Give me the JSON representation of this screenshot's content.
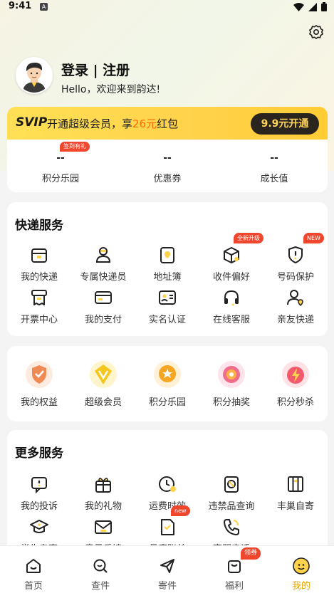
{
  "status_bar": {
    "time": "9:41",
    "a_label": "A"
  },
  "profile": {
    "title": "登录 | 注册",
    "welcome": "Hello，欢迎来到韵达!"
  },
  "svip": {
    "logo": "SVIP",
    "text_before": "开通超级会员，享",
    "amount": "26元",
    "text_after": "红包",
    "button": "9.9元开通"
  },
  "stats": [
    {
      "value": "--",
      "label": "积分乐园",
      "badge": "签到有礼"
    },
    {
      "value": "--",
      "label": "优惠券"
    },
    {
      "value": "--",
      "label": "成长值"
    }
  ],
  "express": {
    "title": "快递服务",
    "items": [
      {
        "label": "我的快递",
        "icon": "package-icon"
      },
      {
        "label": "专属快递员",
        "icon": "courier-icon"
      },
      {
        "label": "地址簿",
        "icon": "address-book-icon"
      },
      {
        "label": "收件偏好",
        "icon": "receive-preference-icon",
        "badge": "全新升级"
      },
      {
        "label": "号码保护",
        "icon": "number-protection-icon",
        "badge": "NEW"
      },
      {
        "label": "开票中心",
        "icon": "invoice-icon"
      },
      {
        "label": "我的支付",
        "icon": "payment-card-icon"
      },
      {
        "label": "实名认证",
        "icon": "id-card-icon"
      },
      {
        "label": "在线客服",
        "icon": "headset-icon"
      },
      {
        "label": "亲友快递",
        "icon": "friends-icon"
      }
    ]
  },
  "benefits": {
    "items": [
      {
        "label": "我的权益",
        "icon": "rights-shield-icon",
        "color": "#f08a54"
      },
      {
        "label": "超级会员",
        "icon": "super-member-icon",
        "color": "#f5c61d"
      },
      {
        "label": "积分乐园",
        "icon": "points-medal-icon",
        "color": "#f5a623"
      },
      {
        "label": "积分抽奖",
        "icon": "lottery-icon",
        "color": "#f06e8c"
      },
      {
        "label": "积分秒杀",
        "icon": "flash-sale-icon",
        "color": "#f25a6e"
      }
    ]
  },
  "more": {
    "title": "更多服务",
    "items": [
      {
        "label": "我的投诉",
        "icon": "complaint-icon"
      },
      {
        "label": "我的礼物",
        "icon": "gift-icon"
      },
      {
        "label": "运费时效",
        "icon": "freight-time-icon"
      },
      {
        "label": "违禁品查询",
        "icon": "prohibited-items-icon"
      },
      {
        "label": "丰巢自寄",
        "icon": "locker-icon"
      },
      {
        "label": "学生专享",
        "icon": "graduation-cap-icon"
      },
      {
        "label": "意见反馈",
        "icon": "feedback-icon"
      },
      {
        "label": "月度账单",
        "icon": "monthly-bill-icon",
        "badge": "new"
      },
      {
        "label": "客服电话",
        "icon": "phone-icon"
      }
    ]
  },
  "tabs": [
    {
      "label": "首页",
      "icon": "home-icon"
    },
    {
      "label": "查件",
      "icon": "search-icon"
    },
    {
      "label": "寄件",
      "icon": "send-icon"
    },
    {
      "label": "福利",
      "icon": "welfare-bag-icon",
      "badge": "领券"
    },
    {
      "label": "我的",
      "icon": "me-face-icon",
      "active": true
    }
  ],
  "colors": {
    "accent": "#ffd24a",
    "badge": "#f0462d",
    "active_tab": "#e8a800"
  }
}
